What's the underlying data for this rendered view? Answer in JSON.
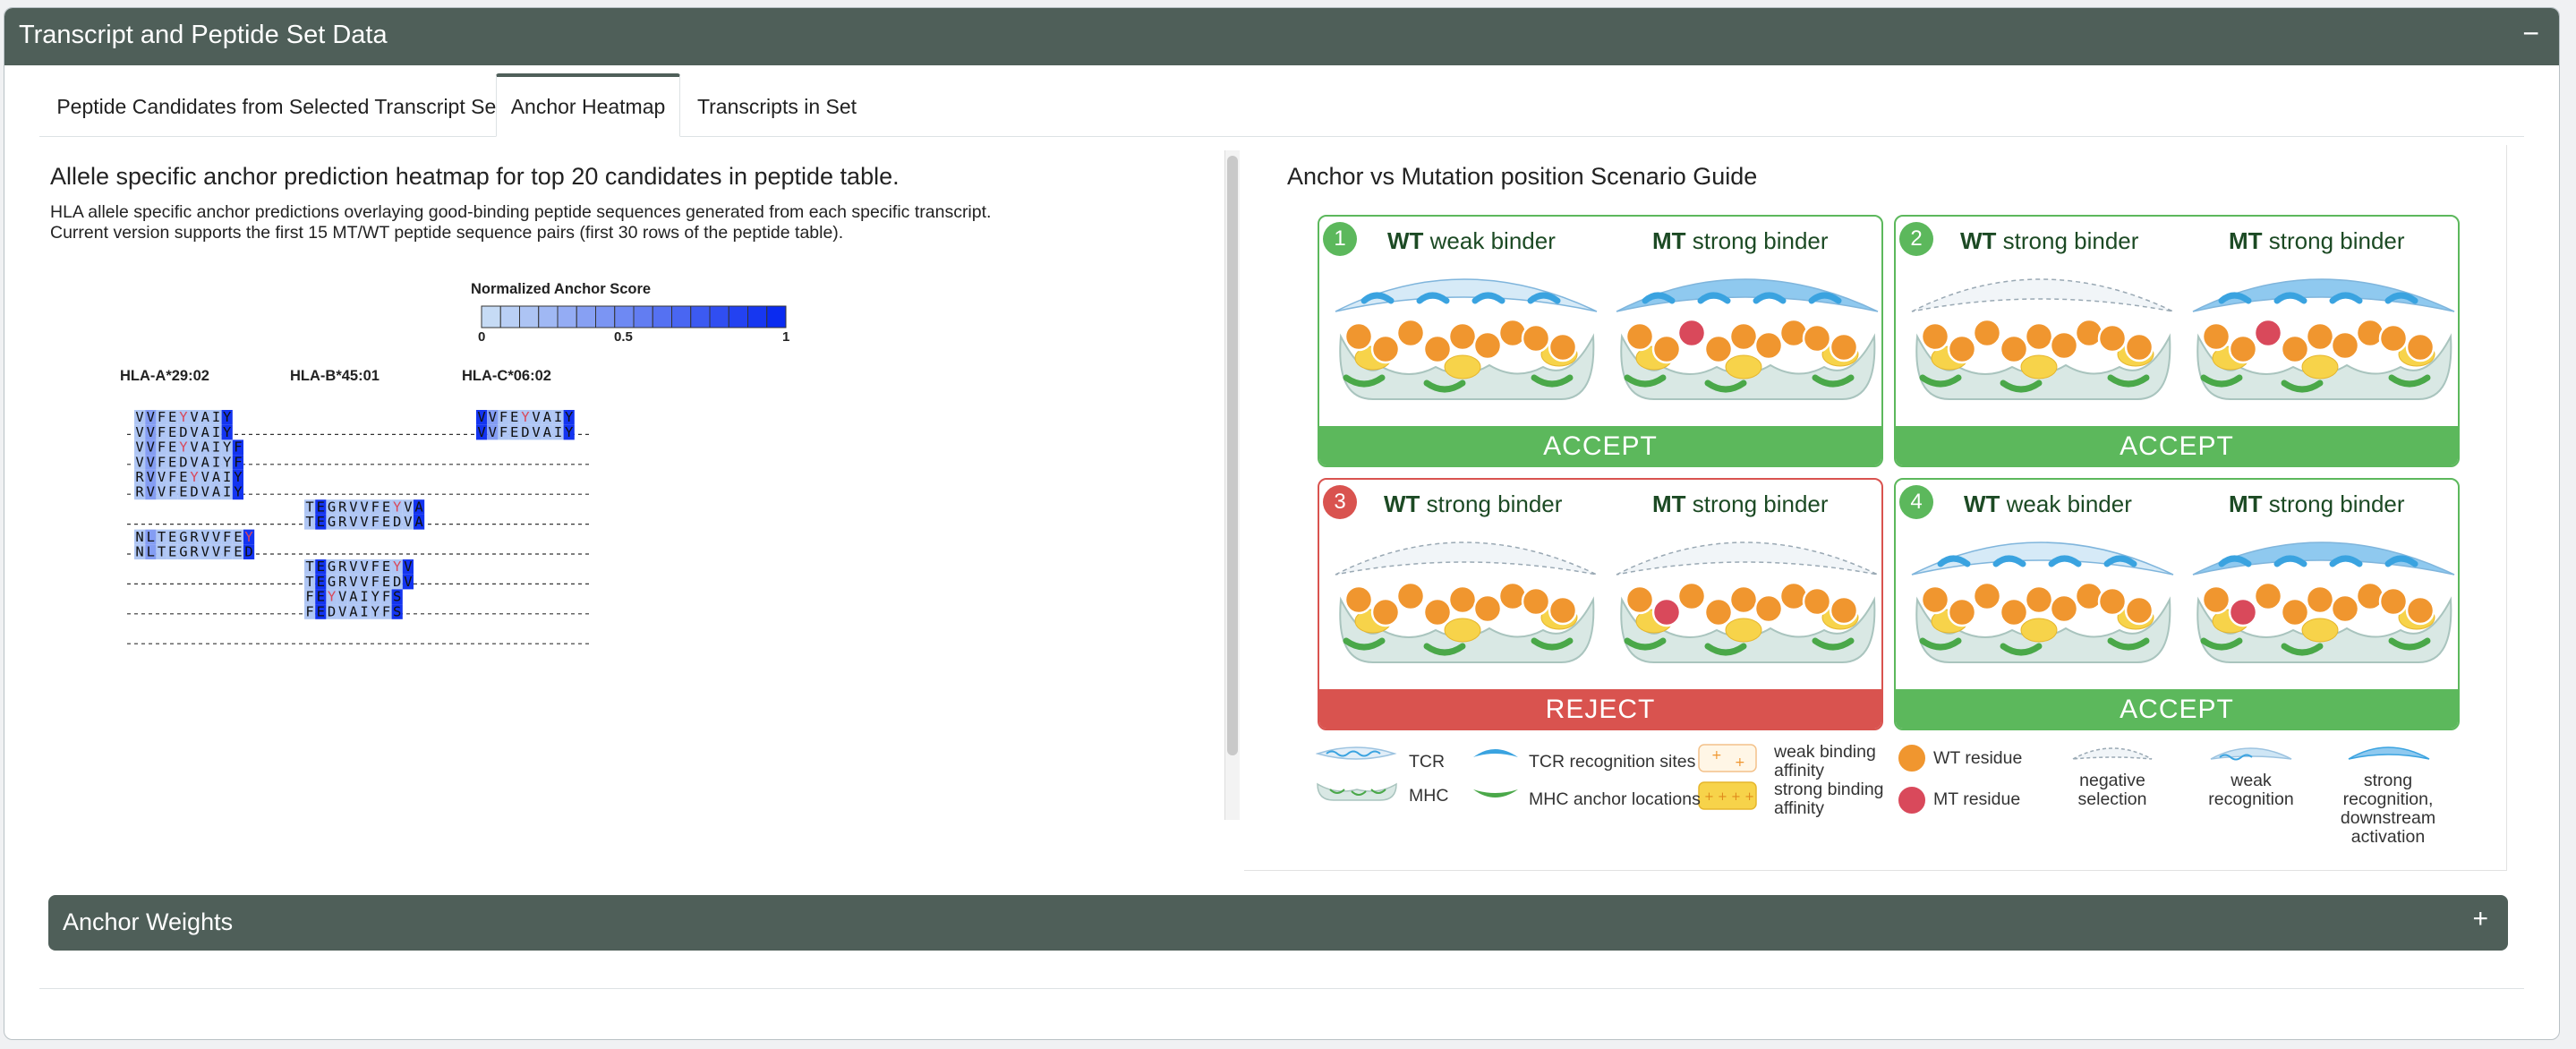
{
  "panel": {
    "title": "Transcript and Peptide Set Data",
    "collapse_icon": "−"
  },
  "tabs": [
    {
      "label": "Peptide Candidates from Selected Transcript Set",
      "active": false
    },
    {
      "label": "Anchor Heatmap",
      "active": true
    },
    {
      "label": "Transcripts in Set",
      "active": false
    }
  ],
  "heatmap_section": {
    "title": "Allele specific anchor prediction heatmap for top 20 candidates in peptide table.",
    "description_line1": "HLA allele specific anchor predictions overlaying good-binding peptide sequences generated from each specific transcript.",
    "description_line2": "Current version supports the first 15 MT/WT peptide sequence pairs (first 30 rows of the peptide table).",
    "scale": {
      "title": "Normalized Anchor Score",
      "tick_min": "0",
      "tick_mid": "0.5",
      "tick_max": "1",
      "color_low": "#c6dbf5",
      "color_high": "#0a2bf0"
    },
    "alleles": [
      "HLA-A*29:02",
      "HLA-B*45:01",
      "HLA-C*06:02"
    ],
    "rows": [
      {
        "col": 2,
        "seq": "VVFEYVAIY",
        "mut": 4
      },
      {
        "col": 0,
        "seq": "VVFEYVAIY",
        "mut": 4
      },
      {
        "col": 2,
        "seq": "VVFEDVAIY",
        "mut": -1
      },
      {
        "col": 0,
        "seq": "VVFEDVAIY",
        "mut": -1
      },
      {
        "col": 0,
        "seq": "VVFEYVAIYF",
        "mut": 4
      },
      {
        "col": 0,
        "seq": "VVFEDVAIYF",
        "mut": -1
      },
      {
        "col": 0,
        "seq": "RVVFEYVAIY",
        "mut": 5
      },
      {
        "col": 0,
        "seq": "RVVFEDVAIY",
        "mut": -1
      },
      {
        "col": 1,
        "seq": "TEGRVVFEYVA",
        "mut": 8
      },
      {
        "col": 1,
        "seq": "TEGRVVFEDVA",
        "mut": -1
      },
      {
        "col": 0,
        "seq": "NLTEGRVVFEY",
        "mut": 10
      },
      {
        "col": 0,
        "seq": "NLTEGRVVFED",
        "mut": -1
      },
      {
        "col": 1,
        "seq": "TEGRVVFEYV",
        "mut": 8
      },
      {
        "col": 1,
        "seq": "TEGRVVFEDV",
        "mut": -1
      },
      {
        "col": 1,
        "seq": "FEYVAIYFS",
        "mut": 2
      },
      {
        "col": 1,
        "seq": "FEDVAIYFS",
        "mut": -1
      }
    ]
  },
  "guide": {
    "title": "Anchor vs Mutation position Scenario Guide",
    "scenarios": [
      {
        "number": "1",
        "wt_prefix": "WT",
        "wt_label": "weak binder",
        "mt_prefix": "MT",
        "mt_label": "strong binder",
        "verdict": "ACCEPT"
      },
      {
        "number": "2",
        "wt_prefix": "WT",
        "wt_label": "strong binder",
        "mt_prefix": "MT",
        "mt_label": "strong binder",
        "verdict": "ACCEPT"
      },
      {
        "number": "3",
        "wt_prefix": "WT",
        "wt_label": "strong binder",
        "mt_prefix": "MT",
        "mt_label": "strong binder",
        "verdict": "REJECT"
      },
      {
        "number": "4",
        "wt_prefix": "WT",
        "wt_label": "weak binder",
        "mt_prefix": "MT",
        "mt_label": "strong binder",
        "verdict": "ACCEPT"
      }
    ],
    "legend": {
      "tcr": "TCR",
      "mhc": "MHC",
      "tcr_sites": "TCR recognition sites",
      "mhc_anchor": "MHC anchor locations",
      "weak_affinity_1": "weak binding",
      "weak_affinity_2": "affinity",
      "strong_affinity_1": "strong binding",
      "strong_affinity_2": "affinity",
      "wt_residue": "WT residue",
      "mt_residue": "MT residue",
      "negative_1": "negative",
      "negative_2": "selection",
      "weak_recog_1": "weak",
      "weak_recog_2": "recognition",
      "strong_recog_1": "strong",
      "strong_recog_2": "recognition,",
      "strong_recog_3": "downstream",
      "strong_recog_4": "activation"
    },
    "colors": {
      "accept": "#5cb85c",
      "reject": "#d9534f",
      "wt": "#f0962f",
      "mt": "#d9495b",
      "tcr": "#3aa3e0",
      "mhc": "#c8dcd8",
      "anchor": "#4aa849",
      "affinity": "#f7d34a"
    }
  },
  "weights_panel": {
    "title": "Anchor Weights",
    "toggle_icon": "+"
  }
}
